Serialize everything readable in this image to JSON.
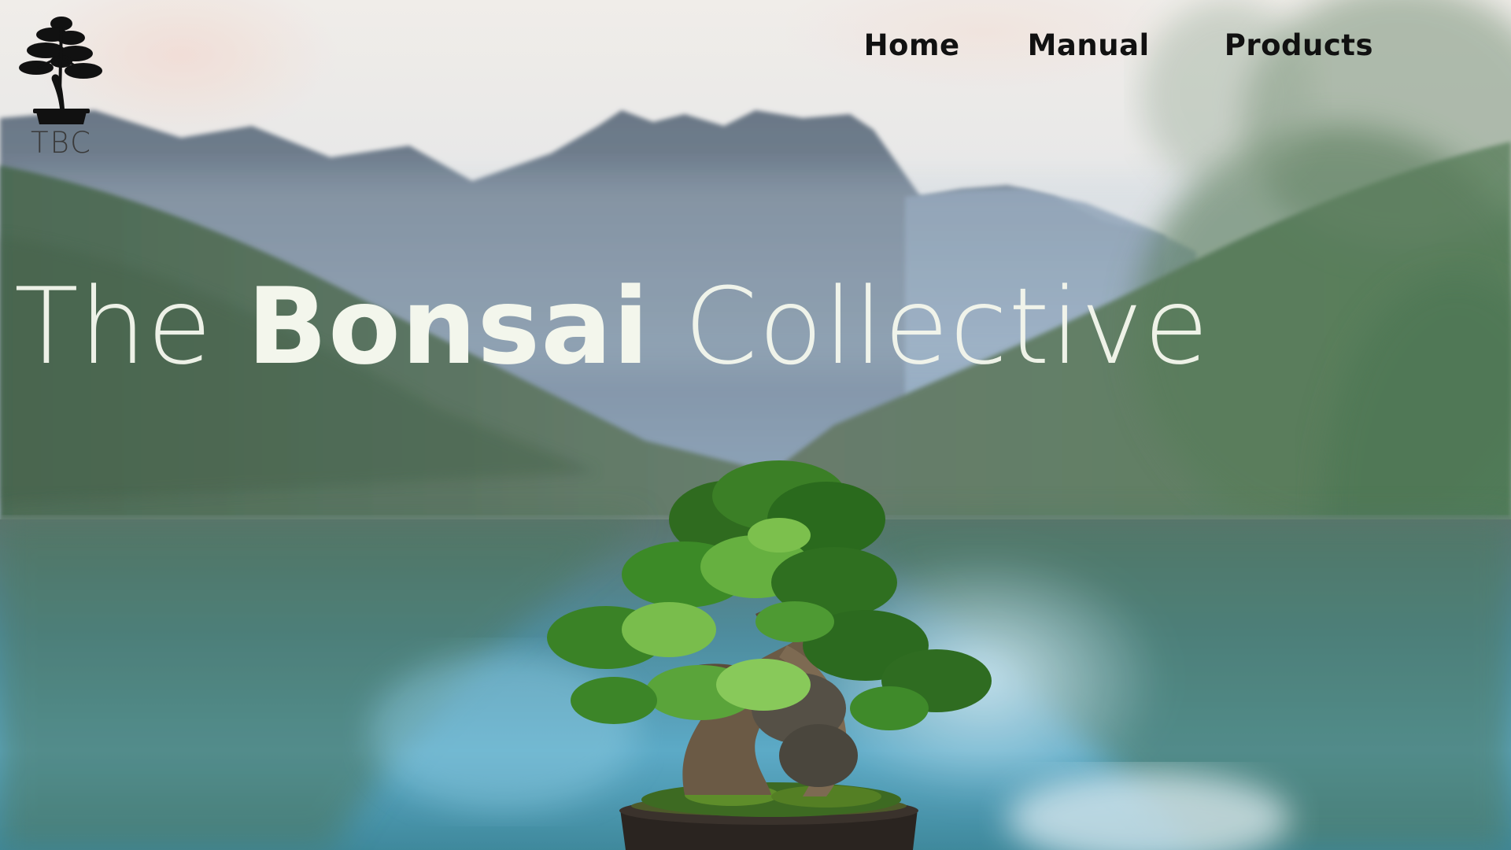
{
  "logo": {
    "text": "TBC",
    "icon": "bonsai-tree-icon"
  },
  "nav": {
    "items": [
      {
        "label": "Home"
      },
      {
        "label": "Manual"
      },
      {
        "label": "Products"
      }
    ]
  },
  "hero": {
    "title_prefix": "The",
    "title_bold": "Bonsai",
    "title_suffix": "Collective",
    "background": "mountain-lake-landscape",
    "feature_image": "potted-bonsai-tree"
  },
  "colors": {
    "title": "#f3f6ec",
    "nav_text": "#111111",
    "logo_text": "#3a3a3a"
  }
}
